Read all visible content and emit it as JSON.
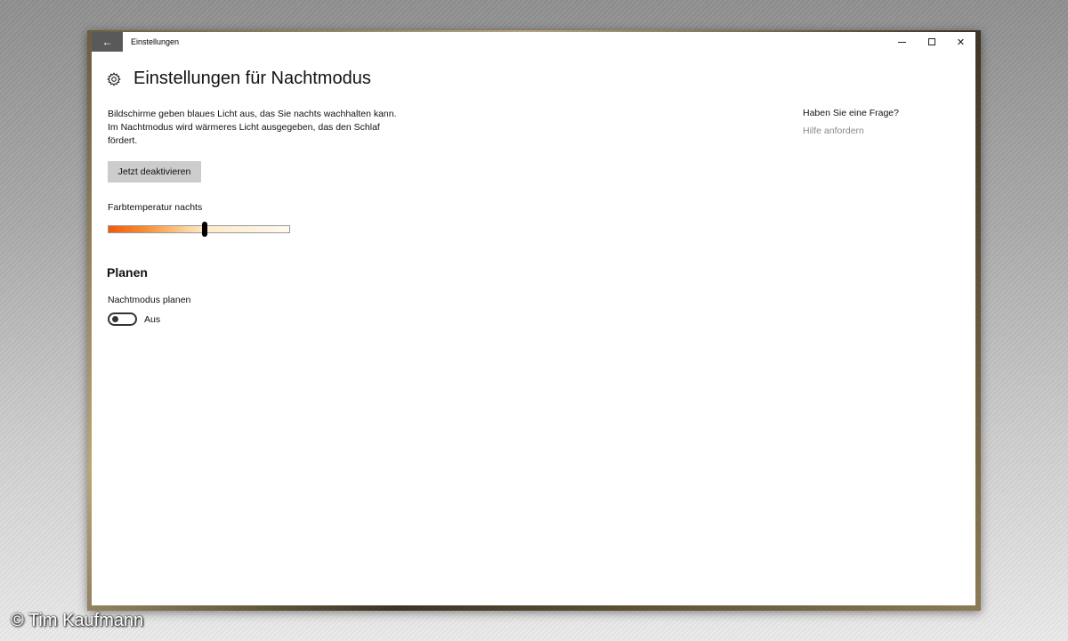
{
  "window": {
    "app_title": "Einstellungen",
    "back_icon": "arrow-left-icon",
    "controls": [
      "minimize-icon",
      "maximize-icon",
      "close-icon"
    ]
  },
  "page": {
    "title": "Einstellungen für Nachtmodus",
    "icon": "gear-icon",
    "description": "Bildschirme geben blaues Licht aus, das Sie nachts wachhalten kann. Im Nachtmodus wird wärmeres Licht ausgegeben, das den Schlaf fördert.",
    "deactivate_button": "Jetzt deaktivieren",
    "color_temp": {
      "label": "Farbtemperatur nachts",
      "value_fraction": 0.53,
      "gradient_start": "#f25a09",
      "gradient_end": "#fffaf0"
    },
    "schedule": {
      "section_title": "Planen",
      "label": "Nachtmodus planen",
      "toggle_state": "Aus",
      "toggle_on": false
    }
  },
  "help": {
    "title": "Haben Sie eine Frage?",
    "link": "Hilfe anfordern"
  },
  "watermark": "© Tim Kaufmann"
}
